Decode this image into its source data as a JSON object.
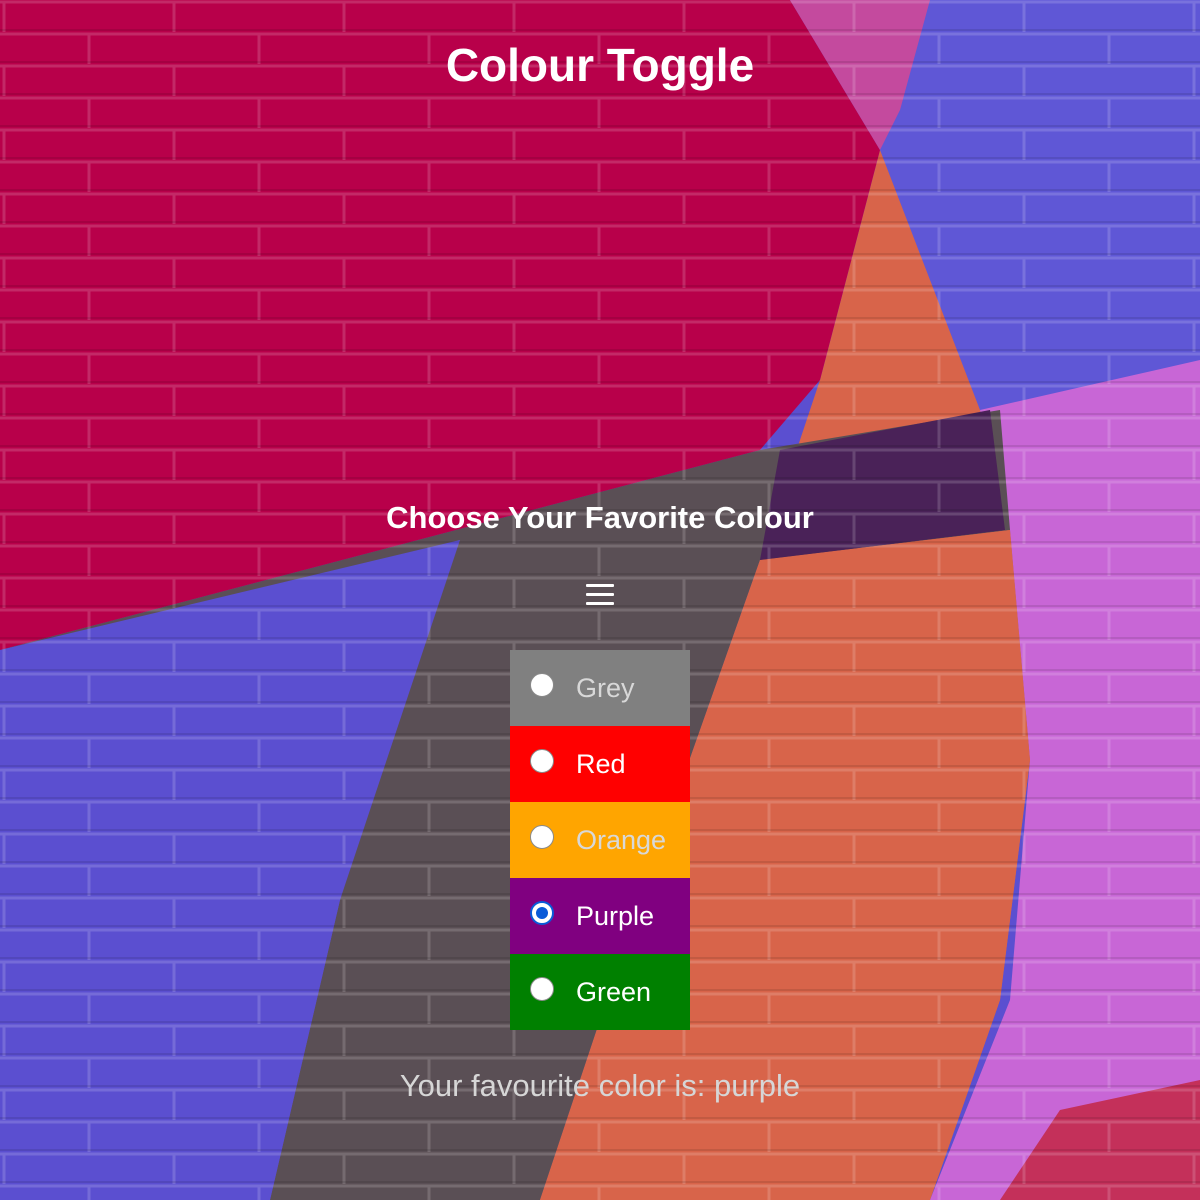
{
  "title": "Colour Toggle",
  "subtitle": "Choose Your Favorite Colour",
  "menu": {
    "icon": "hamburger-icon"
  },
  "options": [
    {
      "label": "Grey",
      "value": "grey",
      "color": "#808080",
      "checked": false
    },
    {
      "label": "Red",
      "value": "red",
      "color": "#ff0000",
      "checked": false
    },
    {
      "label": "Orange",
      "value": "orange",
      "color": "#ffa500",
      "checked": false
    },
    {
      "label": "Purple",
      "value": "purple",
      "color": "#800080",
      "checked": true
    },
    {
      "label": "Green",
      "value": "green",
      "color": "#008000",
      "checked": false
    }
  ],
  "result": {
    "text": "Your favourite color is: purple"
  },
  "colors": {
    "overlay_tint": "#800080",
    "wall_red": "#b8004a",
    "wall_blue": "#5b4fd0",
    "wall_orange": "#d8644a",
    "wall_pink": "#c966d8",
    "wall_dark": "#5a4f55"
  }
}
